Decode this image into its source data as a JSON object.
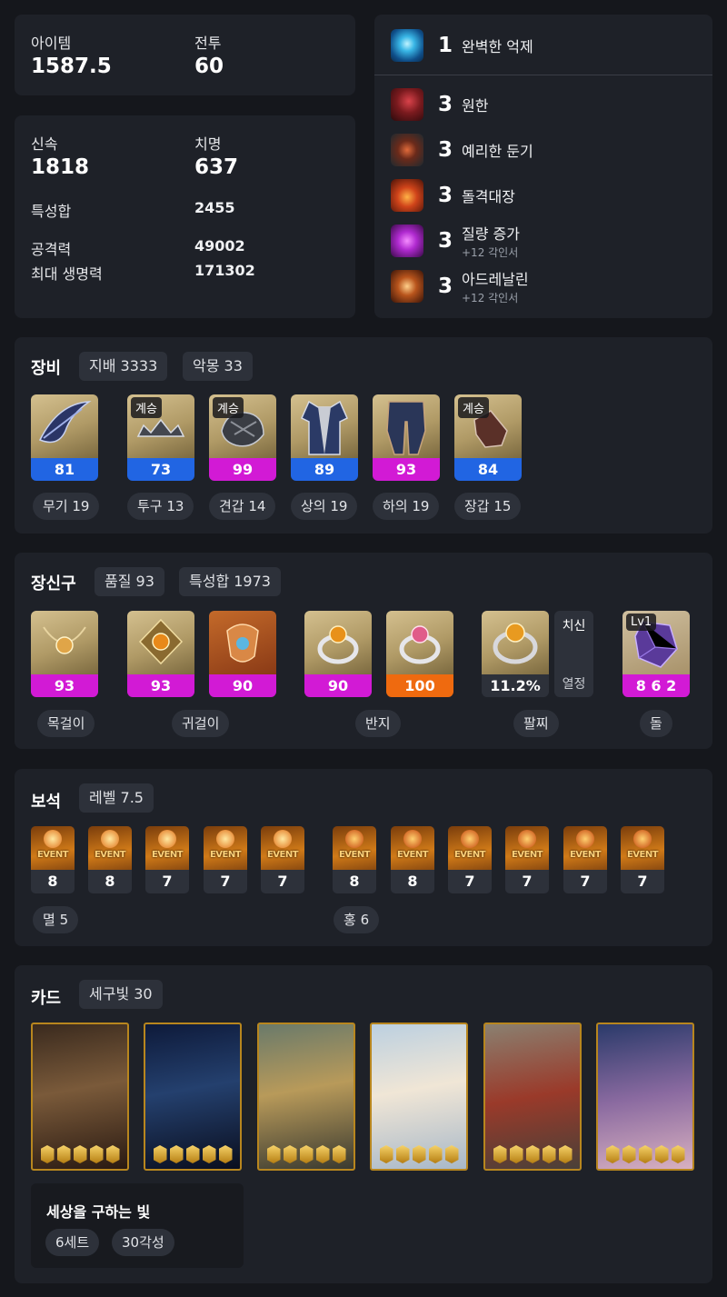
{
  "summary": {
    "item_label": "아이템",
    "item_value": "1587.5",
    "combat_label": "전투",
    "combat_value": "60"
  },
  "stats": {
    "swift_label": "신속",
    "swift_value": "1818",
    "crit_label": "치명",
    "crit_value": "637",
    "total_label": "특성합",
    "total_value": "2455",
    "atk_label": "공격력",
    "atk_value": "49002",
    "hp_label": "최대 생명력",
    "hp_value": "171302"
  },
  "engravings": {
    "top": {
      "level": "1",
      "name": "완벽한 억제"
    },
    "list": [
      {
        "level": "3",
        "name": "원한",
        "sub": ""
      },
      {
        "level": "3",
        "name": "예리한 둔기",
        "sub": ""
      },
      {
        "level": "3",
        "name": "돌격대장",
        "sub": ""
      },
      {
        "level": "3",
        "name": "질량 증가",
        "sub": "+12 각인서"
      },
      {
        "level": "3",
        "name": "아드레날린",
        "sub": "+12 각인서"
      }
    ]
  },
  "equipment": {
    "title": "장비",
    "chips": [
      "지배 3333",
      "악몽 33"
    ],
    "items": [
      {
        "badge": "",
        "quality": "81",
        "label": "무기 19",
        "color": "#2165e3"
      },
      {
        "badge": "계승",
        "quality": "73",
        "label": "투구 13",
        "color": "#2165e3"
      },
      {
        "badge": "계승",
        "quality": "99",
        "label": "견갑 14",
        "color": "#d21ad5"
      },
      {
        "badge": "",
        "quality": "89",
        "label": "상의 19",
        "color": "#2165e3"
      },
      {
        "badge": "",
        "quality": "93",
        "label": "하의 19",
        "color": "#d21ad5"
      },
      {
        "badge": "계승",
        "quality": "84",
        "label": "장갑 15",
        "color": "#2165e3"
      }
    ]
  },
  "accessories": {
    "title": "장신구",
    "chips": [
      "품질 93",
      "특성합 1973"
    ],
    "items": [
      {
        "value": "93"
      },
      {
        "value": "93"
      },
      {
        "value": "90"
      },
      {
        "value": "90"
      },
      {
        "value": "100"
      },
      {
        "value": "11.2%"
      },
      {
        "value": "8 6 2"
      }
    ],
    "bracelet_effects": [
      "치신",
      "열정"
    ],
    "stone_badge": "Lv1",
    "labels": [
      "목걸이",
      "귀걸이",
      "반지",
      "팔찌",
      "돌"
    ]
  },
  "gems": {
    "title": "보석",
    "chip": "레벨 7.5",
    "event_text": "EVENT",
    "left_levels": [
      "8",
      "8",
      "7",
      "7",
      "7"
    ],
    "right_levels": [
      "8",
      "8",
      "7",
      "7",
      "7",
      "7"
    ],
    "left_label": "멸 5",
    "right_label": "홍 6"
  },
  "cards": {
    "title": "카드",
    "chip": "세구빛 30",
    "awakening": [
      5,
      5,
      5,
      5,
      5,
      5
    ],
    "set_name": "세상을 구하는 빛",
    "set_tags": [
      "6세트",
      "30각성"
    ]
  }
}
